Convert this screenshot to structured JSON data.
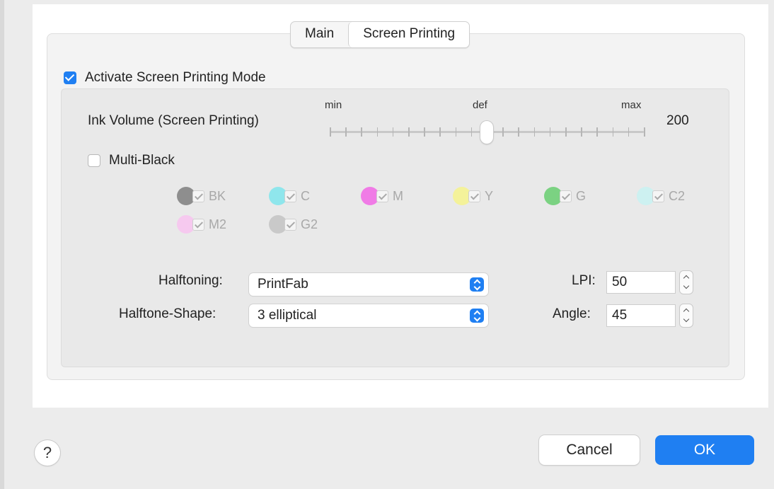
{
  "tabs": [
    {
      "label": "Main",
      "active": false
    },
    {
      "label": "Screen Printing",
      "active": true
    }
  ],
  "activate": {
    "label": "Activate Screen Printing Mode",
    "checked": true
  },
  "ink_volume": {
    "label": "Ink Volume (Screen Printing)",
    "min_label": "min",
    "def_label": "def",
    "max_label": "max",
    "value": "200",
    "slider_position": 0.5
  },
  "multi_black": {
    "label": "Multi-Black",
    "checked": false
  },
  "inks": [
    {
      "label": "BK",
      "color": "#8e8e8e",
      "checked": true
    },
    {
      "label": "C",
      "color": "#8fe6ec",
      "checked": true
    },
    {
      "label": "M",
      "color": "#f07be6",
      "checked": true
    },
    {
      "label": "Y",
      "color": "#f4f29a",
      "checked": true
    },
    {
      "label": "G",
      "color": "#7bd282",
      "checked": true
    },
    {
      "label": "C2",
      "color": "#cdf1f1",
      "checked": true
    },
    {
      "label": "M2",
      "color": "#f6c9ef",
      "checked": true
    },
    {
      "label": "G2",
      "color": "#c9c9c9",
      "checked": true
    }
  ],
  "halftoning": {
    "label": "Halftoning:",
    "value": "PrintFab"
  },
  "halftone_shape": {
    "label": "Halftone-Shape:",
    "value": "3 elliptical"
  },
  "lpi": {
    "label": "LPI:",
    "value": "50"
  },
  "angle": {
    "label": "Angle:",
    "value": "45"
  },
  "buttons": {
    "help": "?",
    "cancel": "Cancel",
    "ok": "OK"
  },
  "colors": {
    "accent": "#1f7ff2"
  }
}
